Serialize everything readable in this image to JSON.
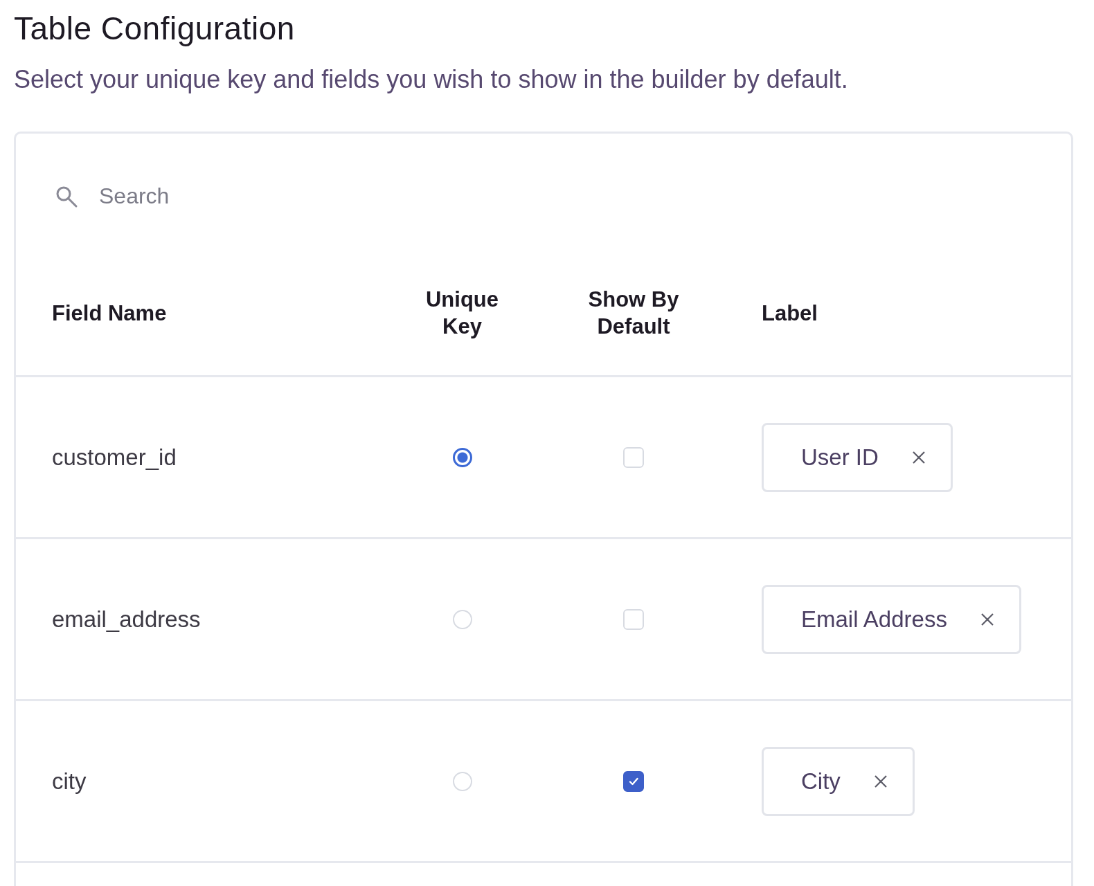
{
  "title": "Table Configuration",
  "subtitle": "Select your unique key and fields you wish to show in the builder by default.",
  "search": {
    "placeholder": "Search"
  },
  "table": {
    "columns": [
      "Field Name",
      "Unique Key",
      "Show By Default",
      "Label"
    ],
    "rows": [
      {
        "field_name": "customer_id",
        "unique_key": {
          "selected": true
        },
        "show_by_default": {
          "checked": false
        },
        "label": "User ID"
      },
      {
        "field_name": "email_address",
        "unique_key": {
          "selected": false
        },
        "show_by_default": {
          "checked": false
        },
        "label": "Email Address"
      },
      {
        "field_name": "city",
        "unique_key": {
          "selected": false
        },
        "show_by_default": {
          "checked": true
        },
        "label": "City"
      }
    ]
  }
}
